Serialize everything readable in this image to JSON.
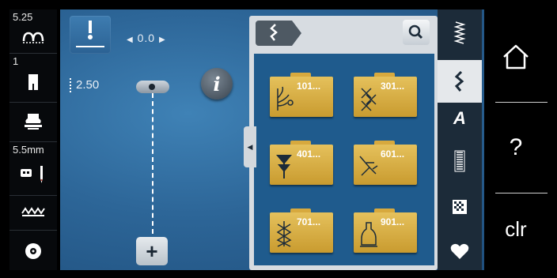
{
  "sidebar": {
    "stitch_width": "5.25",
    "presser_foot_number": "1",
    "needle_size": "5.5mm"
  },
  "controls": {
    "needle_position": "0.0",
    "stitch_length": "2.50",
    "add_button": "+"
  },
  "stitch_folders": [
    {
      "label": "101..."
    },
    {
      "label": "301..."
    },
    {
      "label": "401..."
    },
    {
      "label": "601..."
    },
    {
      "label": "701..."
    },
    {
      "label": "901..."
    }
  ],
  "categories": {
    "alphabets_label": "A",
    "active": "decorative-stitches"
  },
  "right_panel": {
    "help_label": "?",
    "clear_label": "clr"
  },
  "colors": {
    "background": "#2d6698",
    "folder": "#d9b14a",
    "panel": "#d7dce1",
    "sidebar": "#07090c"
  }
}
